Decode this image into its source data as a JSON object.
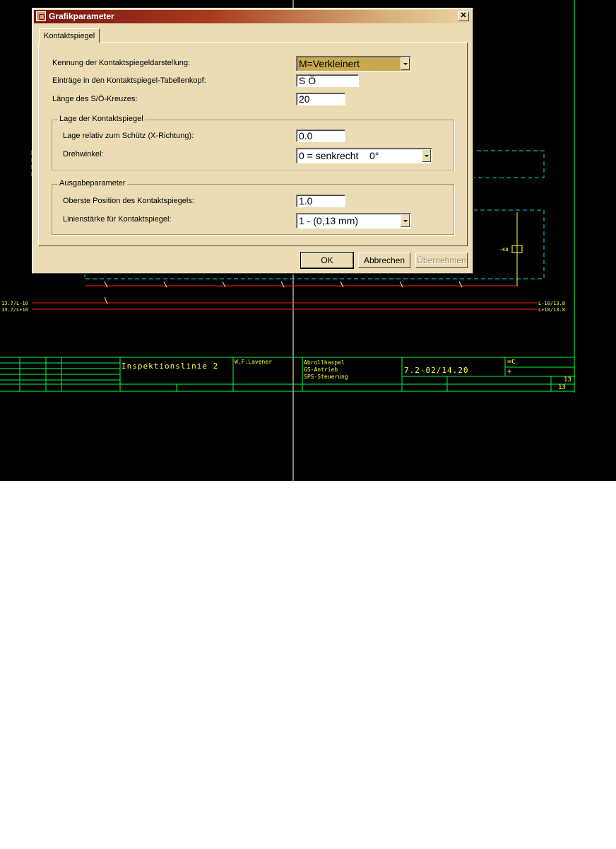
{
  "dialog": {
    "title": "Grafikparameter",
    "close_glyph": "✕",
    "tab_label": "Kontaktspiegel",
    "rows": {
      "kennung_label": "Kennung der Kontaktspiegeldarstellung:",
      "kennung_value": "M=Verkleinert",
      "eintraege_label": "Einträge in den Kontaktspiegel-Tabellenkopf:",
      "eintraege_value": "S Ö",
      "laenge_label": "Länge des S/Ö-Kreuzes:",
      "laenge_value": "20"
    },
    "lage_group": {
      "title": "Lage der Kontaktspiegel",
      "relativ_label": "Lage relativ zum Schütz (X-Richtung):",
      "relativ_value": "0.0",
      "drehwinkel_label": "Drehwinkel:",
      "drehwinkel_value": "0 = senkrecht    0°"
    },
    "ausgabe_group": {
      "title": "Ausgabeparameter",
      "oberste_label": "Oberste Position des Kontaktspiegels:",
      "oberste_value": "1.0",
      "linien_label": "Linienstärke für Kontaktspiegel:",
      "linien_value": "1 - (0,13 mm)"
    },
    "buttons": {
      "ok": "OK",
      "cancel": "Abbrechen",
      "apply": "Übernehmen"
    }
  },
  "cad": {
    "title_block": {
      "drawing_name": "Inspektionslinie 2",
      "author": "W.F.Lavener",
      "desc_line1": "Abrollhaspel",
      "desc_line2": "GS-Antrieb",
      "desc_line3": "SPS-Steuerung",
      "doc_number": "7.2-02/14.20",
      "field_eq": "=C",
      "field_plus": "+",
      "sheet": "13",
      "sheet_total": "13"
    },
    "wire_labels": {
      "left_l10": "13.7/L-10",
      "left_l10b": "13.7/L+10",
      "right_l10": "L-10/13.8",
      "right_l10b": "L+10/13.8",
      "relay": "-K8"
    },
    "colors": {
      "background": "#000000",
      "grid": "#00ff40",
      "wire": "#ff2020",
      "text": "#ffff40",
      "cyan": "#00e0e0"
    }
  }
}
